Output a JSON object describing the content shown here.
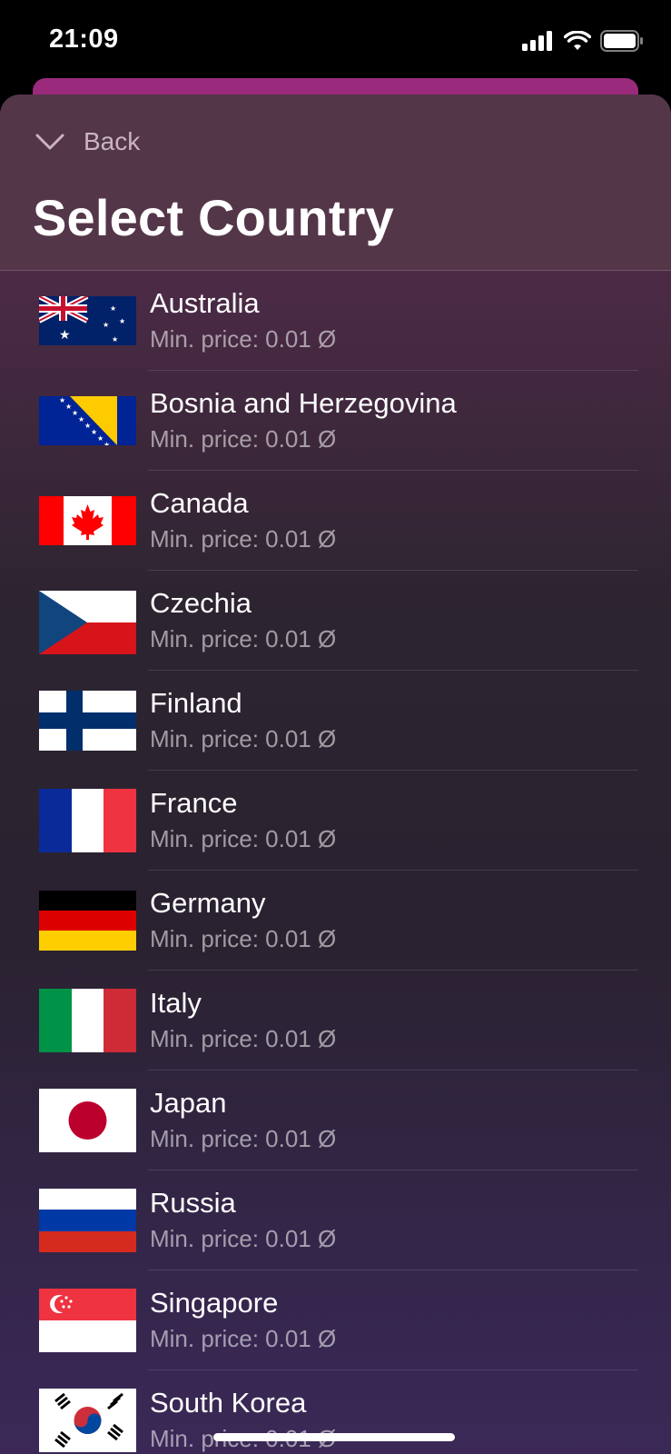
{
  "status_bar": {
    "time": "21:09",
    "icons": [
      "cellular-signal-icon",
      "wifi-icon",
      "battery-icon"
    ]
  },
  "header": {
    "back_label": "Back",
    "back_icon": "chevron-down-icon",
    "title": "Select Country"
  },
  "countries": [
    {
      "name": "Australia",
      "price": "Min. price: 0.01 Ø",
      "flag": "australia-flag-icon"
    },
    {
      "name": "Bosnia and Herzegovina",
      "price": "Min. price: 0.01 Ø",
      "flag": "bosnia-flag-icon"
    },
    {
      "name": "Canada",
      "price": "Min. price: 0.01 Ø",
      "flag": "canada-flag-icon"
    },
    {
      "name": "Czechia",
      "price": "Min. price: 0.01 Ø",
      "flag": "czechia-flag-icon"
    },
    {
      "name": "Finland",
      "price": "Min. price: 0.01 Ø",
      "flag": "finland-flag-icon"
    },
    {
      "name": "France",
      "price": "Min. price: 0.01 Ø",
      "flag": "france-flag-icon"
    },
    {
      "name": "Germany",
      "price": "Min. price: 0.01 Ø",
      "flag": "germany-flag-icon"
    },
    {
      "name": "Italy",
      "price": "Min. price: 0.01 Ø",
      "flag": "italy-flag-icon"
    },
    {
      "name": "Japan",
      "price": "Min. price: 0.01 Ø",
      "flag": "japan-flag-icon"
    },
    {
      "name": "Russia",
      "price": "Min. price: 0.01 Ø",
      "flag": "russia-flag-icon"
    },
    {
      "name": "Singapore",
      "price": "Min. price: 0.01 Ø",
      "flag": "singapore-flag-icon"
    },
    {
      "name": "South Korea",
      "price": "Min. price: 0.01 Ø",
      "flag": "south-korea-flag-icon"
    }
  ],
  "colors": {
    "accent": "#9a2a7c",
    "sheet_header": "#543649",
    "secondary_text": "#c9b5c2"
  }
}
